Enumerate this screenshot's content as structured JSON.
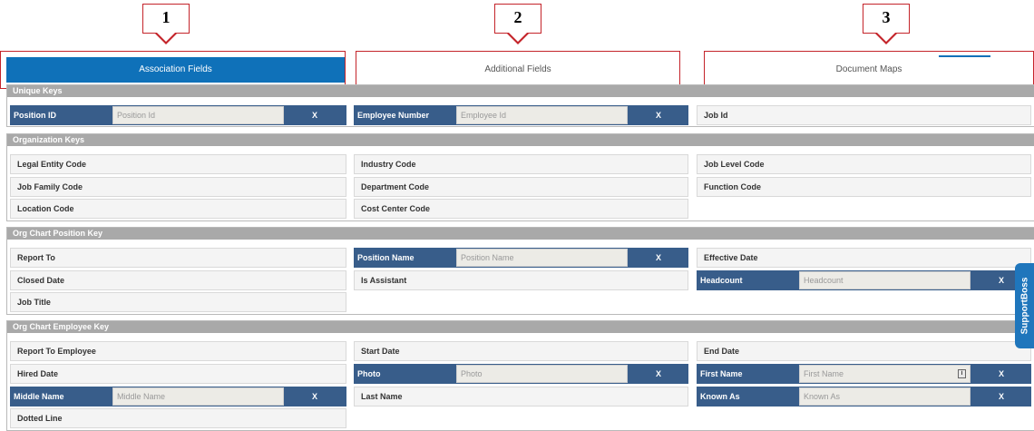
{
  "callouts": [
    "1",
    "2",
    "3"
  ],
  "tabs": [
    {
      "label": "Association Fields"
    },
    {
      "label": "Additional Fields"
    },
    {
      "label": "Document Maps"
    }
  ],
  "sections": {
    "unique_keys": {
      "title": "Unique Keys",
      "position_id": {
        "label": "Position ID",
        "placeholder": "Position Id",
        "clear": "X"
      },
      "employee_number": {
        "label": "Employee Number",
        "placeholder": "Employee Id",
        "clear": "X"
      },
      "job_id": "Job Id"
    },
    "organization_keys": {
      "title": "Organization Keys",
      "legal_entity_code": "Legal Entity Code",
      "industry_code": "Industry Code",
      "job_level_code": "Job Level Code",
      "job_family_code": "Job Family Code",
      "department_code": "Department Code",
      "function_code": "Function Code",
      "location_code": "Location Code",
      "cost_center_code": "Cost Center Code"
    },
    "org_chart_position_key": {
      "title": "Org Chart Position Key",
      "report_to": "Report To",
      "position_name": {
        "label": "Position Name",
        "placeholder": "Position Name",
        "clear": "X"
      },
      "effective_date": "Effective Date",
      "closed_date": "Closed Date",
      "is_assistant": "Is Assistant",
      "headcount": {
        "label": "Headcount",
        "placeholder": "Headcount",
        "clear": "X"
      },
      "job_title": "Job Title"
    },
    "org_chart_employee_key": {
      "title": "Org Chart Employee Key",
      "report_to_employee": "Report To Employee",
      "start_date": "Start Date",
      "end_date": "End Date",
      "hired_date": "Hired Date",
      "photo": {
        "label": "Photo",
        "placeholder": "Photo",
        "clear": "X"
      },
      "first_name": {
        "label": "First Name",
        "placeholder": "First Name",
        "clear": "X",
        "info": "i"
      },
      "middle_name": {
        "label": "Middle Name",
        "placeholder": "Middle Name",
        "clear": "X"
      },
      "last_name": "Last Name",
      "known_as": {
        "label": "Known As",
        "placeholder": "Known As",
        "clear": "X"
      },
      "dotted_line": "Dotted Line"
    }
  },
  "support_widget": {
    "label": "SupportBoss"
  },
  "colors": {
    "accent": "#0f71b9",
    "required_field": "#385d8a",
    "section_header": "#a9a9a9",
    "callout_border": "#c4242a"
  }
}
